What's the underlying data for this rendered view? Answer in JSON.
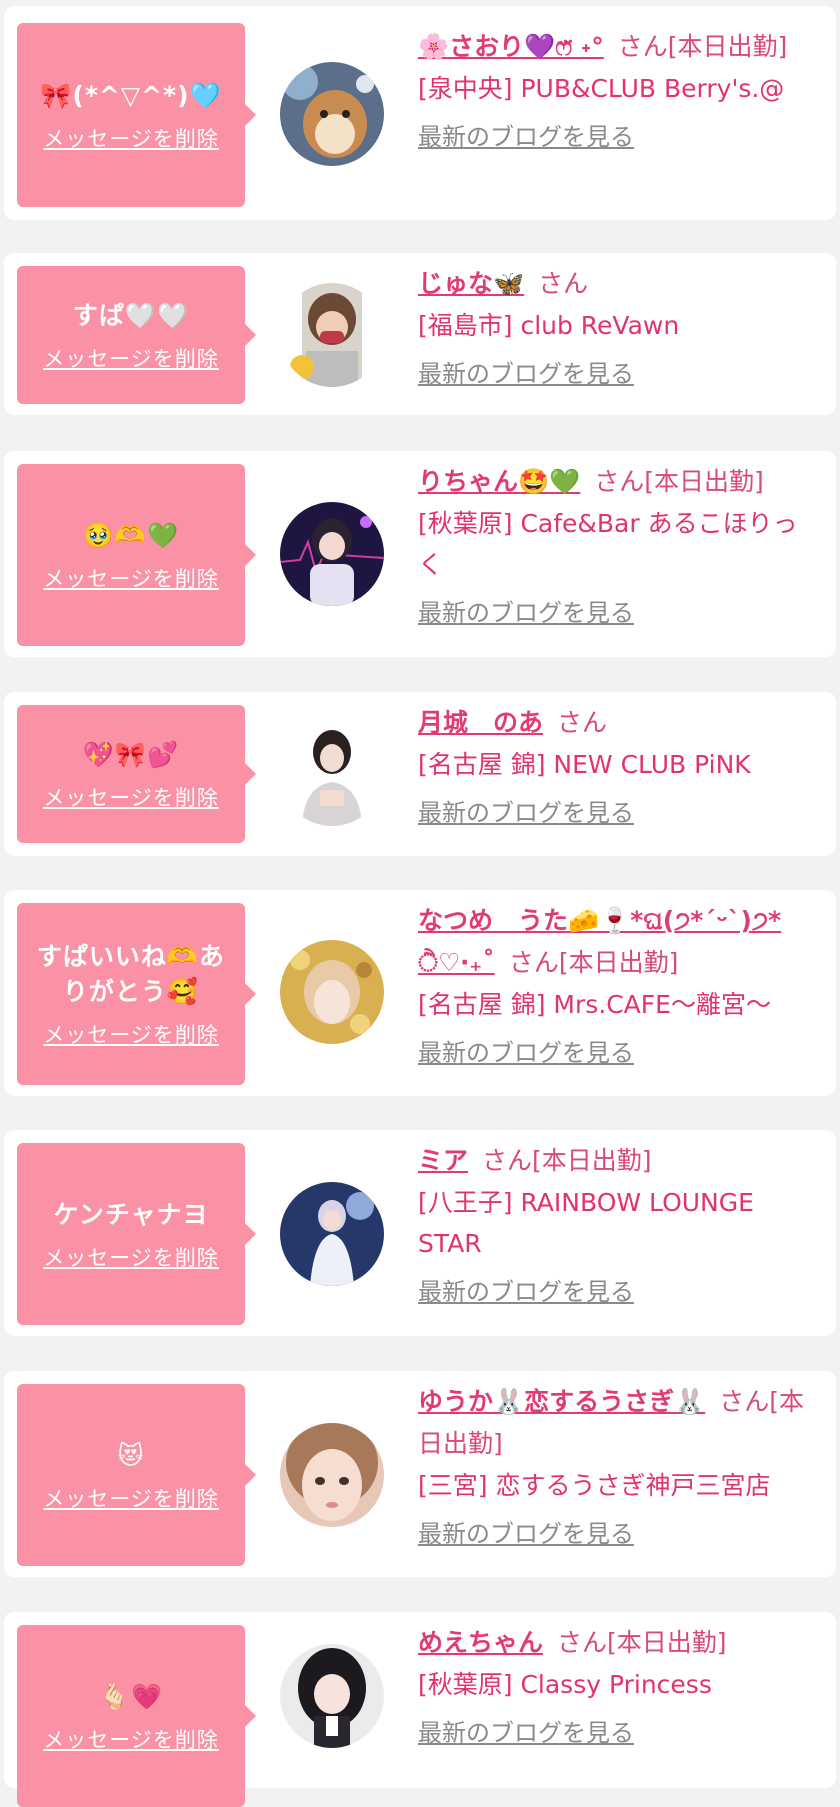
{
  "delete_label": "メッセージを削除",
  "blog_label": "最新のブログを見る",
  "colors": {
    "bubble": "#fb91a4",
    "name": "#e23a72",
    "shop": "#e2336b",
    "link_gray": "#8a8a8a"
  },
  "items": [
    {
      "message": "🎀(*^▽^*)🩵",
      "name": "🌸さおり💜ෆ̈ ˖°",
      "suffix": "さん[本日出勤]",
      "shop": "[泉中央] PUB&CLUB Berry's.@",
      "avatar": "hamster-plush-photo"
    },
    {
      "message": "すぱ🤍🤍",
      "name": "じゅな🦋",
      "suffix": "さん",
      "shop": "[福島市] club ReVawn",
      "avatar": "girl-with-mask-photo"
    },
    {
      "message": "🥹🫶💚",
      "name": "りちゃん🤩💚",
      "suffix": "さん[本日出勤]",
      "shop": "[秋葉原] Cafe&Bar あるこほりっく",
      "avatar": "idol-neon-photo"
    },
    {
      "message": "💖🎀💕",
      "name": "月城　のあ",
      "suffix": "さん",
      "shop": "[名古屋 錦] NEW CLUB PiNK",
      "avatar": "hostess-portrait-photo"
    },
    {
      "message": "すぱいいね🫶ありがとう🥰",
      "name": "なつめ　うた🧀🍷*ଘ(੭*ˊᵕˋ)੭* ੈ♡‧₊˚",
      "suffix": "さん[本日出勤]",
      "shop": "[名古屋 錦] Mrs.CAFE〜離宮〜",
      "avatar": "glitter-portrait-photo"
    },
    {
      "message": "ケンチャナヨ",
      "name": "ミア",
      "suffix": "さん[本日出勤]",
      "shop": "[八王子] RAINBOW LOUNGE STAR",
      "avatar": "fantasy-dress-photo"
    },
    {
      "message": "😻",
      "name": "ゆうか🐰恋するうさぎ🐰",
      "suffix": "さん[本日出勤]",
      "shop": "[三宮] 恋するうさぎ神戸三宮店",
      "avatar": "selfie-closeup-photo"
    },
    {
      "message": "🫰🏻💗",
      "name": "めえちゃん",
      "suffix": "さん[本日出勤]",
      "shop": "[秋葉原] Classy Princess",
      "avatar": "gothic-doll-photo"
    }
  ]
}
